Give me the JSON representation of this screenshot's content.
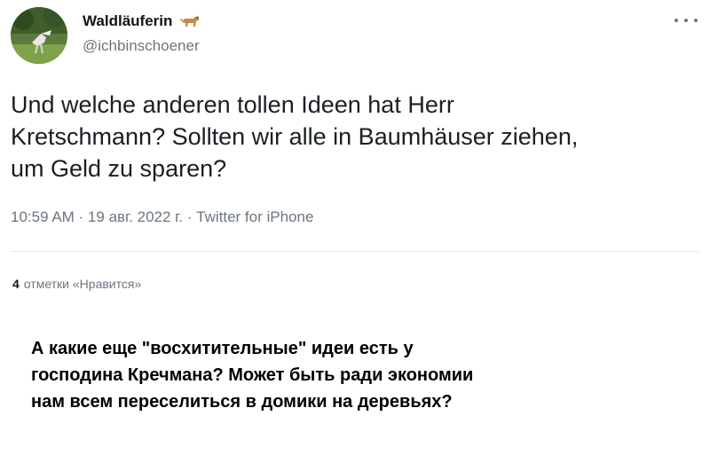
{
  "author": {
    "display_name": "Waldläuferin",
    "handle": "@ichbinschoener",
    "name_emoji": "dog-icon"
  },
  "tweet": {
    "text": "Und welche anderen tollen Ideen hat Herr\nKretschmann? Sollten wir alle in Baumhäuser ziehen,\num Geld zu sparen?",
    "meta": "10:59 AM · 19 авг. 2022 г. · Twitter for iPhone",
    "likes_count": "4",
    "likes_label": "отметки «Нравится»"
  },
  "translation": {
    "text": "А какие еще \"восхитительные\" идеи есть у\nгосподина Кречмана? Может быть ради экономии\nнам всем переселиться в домики на деревьях?"
  },
  "colors": {
    "text": "#0f1419",
    "secondary": "#6b7580",
    "divider": "#e6eaee"
  }
}
